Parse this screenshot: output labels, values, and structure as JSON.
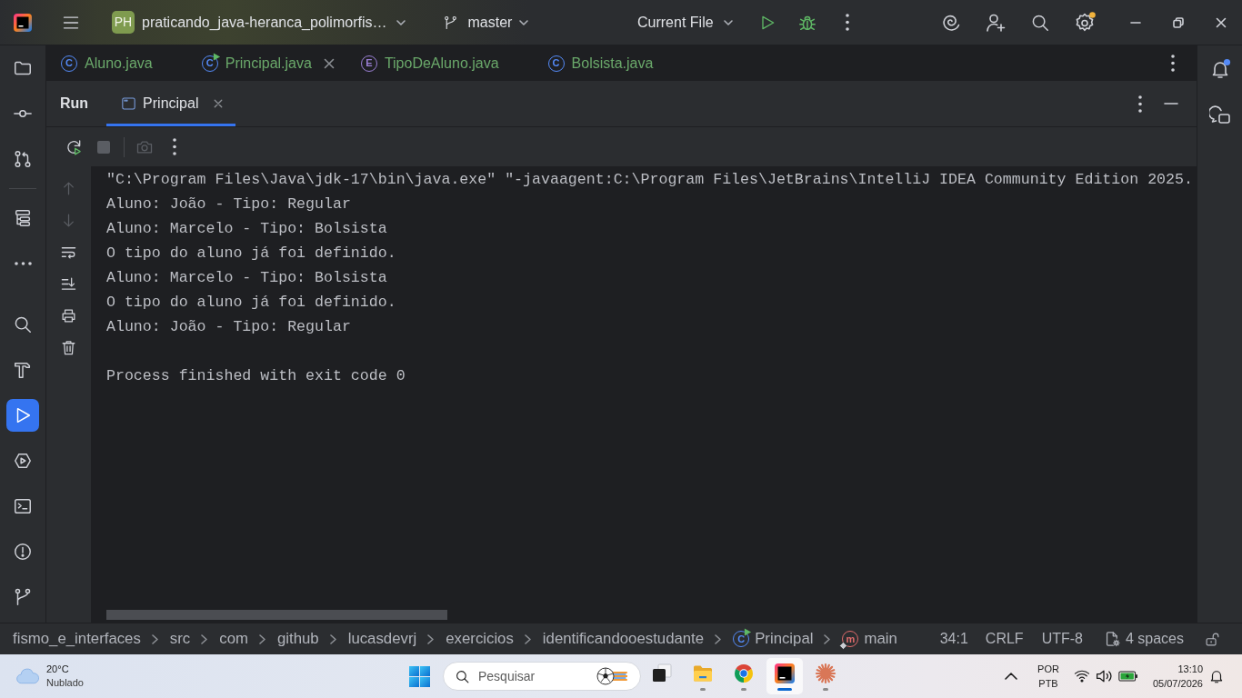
{
  "title_bar": {
    "project_badge": "PH",
    "project": "praticando_java-heranca_polimorfis…",
    "branch": "master",
    "run_config": "Current File",
    "settings_update": true
  },
  "left_toolbar": [
    {
      "selected": false
    },
    {
      "selected": false
    },
    {
      "selected": false
    },
    {
      "selected": false
    },
    {
      "selected": false
    },
    {
      "selected": false
    },
    {
      "selected": false
    },
    {
      "selected": true
    },
    {
      "selected": false
    },
    {
      "selected": false
    },
    {
      "selected": false
    },
    {
      "selected": false
    }
  ],
  "right_toolbar": {
    "notifications_unread": true
  },
  "editor_tabs": [
    {
      "label": "Aluno.java",
      "kind": "class",
      "type_letter": "C",
      "selected": false
    },
    {
      "label": "Principal.java",
      "kind": "main_class",
      "type_letter": "C",
      "selected": true
    },
    {
      "label": "TipoDeAluno.java",
      "kind": "enum",
      "type_letter": "E",
      "selected": false
    },
    {
      "label": "Bolsista.java",
      "kind": "class",
      "type_letter": "C",
      "selected": false
    }
  ],
  "run_panel": {
    "title": "Run",
    "tabs": [
      {
        "label": "Principal",
        "selected": true
      }
    ],
    "toolbar": [
      {
        "disabled": false
      },
      {
        "disabled": true
      },
      {
        "disabled": true
      },
      {
        "disabled": false
      }
    ],
    "gutter": [
      {
        "disabled": true
      },
      {
        "disabled": true
      },
      {
        "disabled": false
      },
      {
        "disabled": false
      },
      {
        "disabled": false
      },
      {
        "disabled": false
      }
    ],
    "console": {
      "command": "\"C:\\Program Files\\Java\\jdk-17\\bin\\java.exe\" \"-javaagent:C:\\Program Files\\JetBrains\\IntelliJ IDEA Community Edition 2025.",
      "output": [
        "Aluno: João - Tipo: Regular",
        "Aluno: Marcelo - Tipo: Bolsista",
        "O tipo do aluno já foi definido.",
        "Aluno: Marcelo - Tipo: Bolsista",
        "O tipo do aluno já foi definido.",
        "Aluno: João - Tipo: Regular"
      ],
      "exit_message": "Process finished with exit code 0"
    }
  },
  "status_bar": {
    "breadcrumbs": [
      {
        "label": "fismo_e_interfaces",
        "kind": "package"
      },
      {
        "label": "src",
        "kind": "package"
      },
      {
        "label": "com",
        "kind": "package"
      },
      {
        "label": "github",
        "kind": "package"
      },
      {
        "label": "lucasdevrj",
        "kind": "package"
      },
      {
        "label": "exercicios",
        "kind": "package"
      },
      {
        "label": "identificandooestudante",
        "kind": "package"
      },
      {
        "label": "Principal",
        "kind": "main_class",
        "type_letter": "C"
      },
      {
        "label": "main",
        "kind": "method",
        "type_letter": "m"
      }
    ],
    "position": "34:1",
    "line_separator": "CRLF",
    "encoding": "UTF-8",
    "indent": "4 spaces"
  },
  "taskbar": {
    "weather": {
      "temperature": "20°C",
      "condition": "Nublado"
    },
    "search_placeholder": "Pesquisar",
    "apps": [
      {
        "running": false,
        "selected": false
      },
      {
        "running": true,
        "selected": false
      },
      {
        "running": true,
        "selected": false
      },
      {
        "running": true,
        "selected": true
      },
      {
        "running": true,
        "selected": false
      }
    ],
    "language": "POR",
    "keyboard": "PTB",
    "time": "13:10",
    "date": "05/07/2026"
  }
}
